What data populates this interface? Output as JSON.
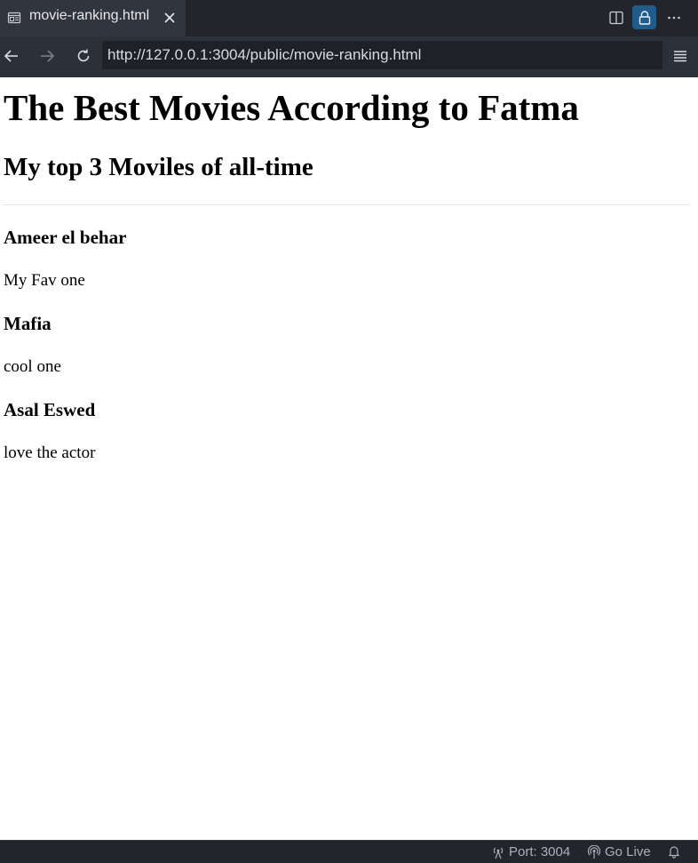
{
  "tab": {
    "title": "movie-ranking.html",
    "icon": "preview-page-icon",
    "close_icon": "close-icon"
  },
  "toolbar": {
    "split_icon": "split-editor-icon",
    "lock_icon": "lock-icon",
    "more_icon": "more-actions-icon",
    "accent": "#1f5c8c"
  },
  "navigation": {
    "back_icon": "arrow-left-icon",
    "forward_icon": "arrow-right-icon",
    "reload_icon": "reload-icon",
    "url": "http://127.0.0.1:3004/public/movie-ranking.html",
    "menu_icon": "hamburger-menu-icon"
  },
  "page": {
    "title": "The Best Movies According to Fatma",
    "subtitle": "My top 3 Moviles of all-time",
    "movies": [
      {
        "name": "Ameer el behar",
        "comment": "My Fav one"
      },
      {
        "name": "Mafia",
        "comment": "cool one"
      },
      {
        "name": "Asal Eswed",
        "comment": "love the actor"
      }
    ]
  },
  "statusbar": {
    "port": "Port: 3004",
    "go_live": "Go Live",
    "bell_icon": "bell-icon"
  }
}
